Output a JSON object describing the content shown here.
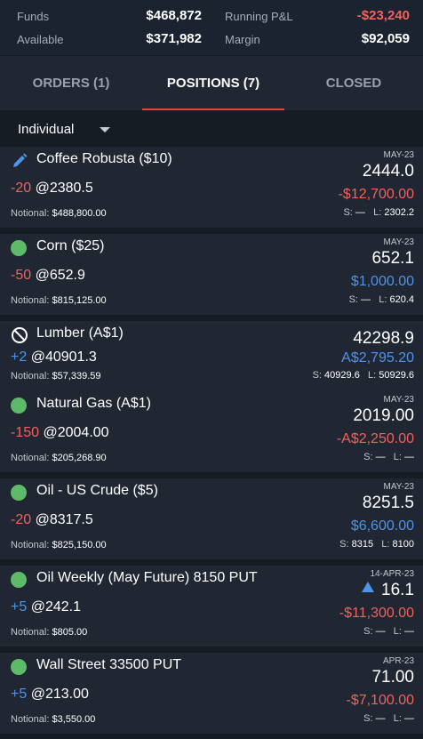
{
  "account": {
    "funds_label": "Funds",
    "funds_value": "$468,872",
    "running_pnl_label": "Running P&L",
    "running_pnl_value": "-$23,240",
    "available_label": "Available",
    "available_value": "$371,982",
    "margin_label": "Margin",
    "margin_value": "$92,059"
  },
  "tabs": [
    {
      "label": "ORDERS (1)",
      "active": false
    },
    {
      "label": "POSITIONS (7)",
      "active": true
    },
    {
      "label": "CLOSED",
      "active": false
    }
  ],
  "filter": {
    "label": "Individual"
  },
  "colors": {
    "accent": "#e8403a",
    "negative": "#f0625c",
    "positive": "#4f94e6",
    "status_ok": "#5dba68",
    "card_bg": "#202733",
    "page_bg": "#161c24"
  },
  "positions": [
    {
      "icon": "pencil-icon",
      "name": "Coffee Robusta ($10)",
      "month": "MAY-23",
      "last": "2444.0",
      "qty": "-20",
      "at": "@",
      "entry": "2380.5",
      "pnl": "-$12,700.00",
      "notional_label": "Notional:",
      "notional": "$488,800.00",
      "stop_label": "S:",
      "stop": "—",
      "limit_label": "L:",
      "limit": "2302.2"
    },
    {
      "icon": "status-dot-icon",
      "name": "Corn ($25)",
      "month": "MAY-23",
      "last": "652.1",
      "qty": "-50",
      "at": "@",
      "entry": "652.9",
      "pnl": "$1,000.00",
      "notional_label": "Notional:",
      "notional": "$815,125.00",
      "stop_label": "S:",
      "stop": "—",
      "limit_label": "L:",
      "limit": "620.4"
    },
    {
      "icon": "prohibited-icon",
      "name": "Lumber (A$1)",
      "month": "",
      "last": "42298.9",
      "qty": "+2",
      "at": "@",
      "entry": "40901.3",
      "pnl": "A$2,795.20",
      "notional_label": "Notional:",
      "notional": "$57,339.59",
      "stop_label": "S:",
      "stop": "40929.6",
      "limit_label": "L:",
      "limit": "50929.6"
    },
    {
      "icon": "status-dot-icon",
      "name": "Natural Gas (A$1)",
      "month": "MAY-23",
      "last": "2019.00",
      "qty": "-150",
      "at": "@",
      "entry": "2004.00",
      "pnl": "-A$2,250.00",
      "notional_label": "Notional:",
      "notional": "$205,268.90",
      "stop_label": "S:",
      "stop": "—",
      "limit_label": "L:",
      "limit": "—"
    },
    {
      "icon": "status-dot-icon",
      "name": "Oil - US Crude ($5)",
      "month": "MAY-23",
      "last": "8251.5",
      "qty": "-20",
      "at": "@",
      "entry": "8317.5",
      "pnl": "$6,600.00",
      "notional_label": "Notional:",
      "notional": "$825,150.00",
      "stop_label": "S:",
      "stop": "8315",
      "limit_label": "L:",
      "limit": "8100"
    },
    {
      "icon": "status-dot-icon",
      "name": "Oil Weekly (May Future) 8150 PUT",
      "month": "14-APR-23",
      "last": "16.1",
      "qty": "+5",
      "at": "@",
      "entry": "242.1",
      "pnl": "-$11,300.00",
      "notional_label": "Notional:",
      "notional": "$805.00",
      "stop_label": "S:",
      "stop": "—",
      "limit_label": "L:",
      "limit": "—"
    },
    {
      "icon": "status-dot-icon",
      "name": "Wall Street 33500 PUT",
      "month": "APR-23",
      "last": "71.00",
      "qty": "+5",
      "at": "@",
      "entry": "213.00",
      "pnl": "-$7,100.00",
      "notional_label": "Notional:",
      "notional": "$3,550.00",
      "stop_label": "S:",
      "stop": "—",
      "limit_label": "L:",
      "limit": "—"
    }
  ]
}
